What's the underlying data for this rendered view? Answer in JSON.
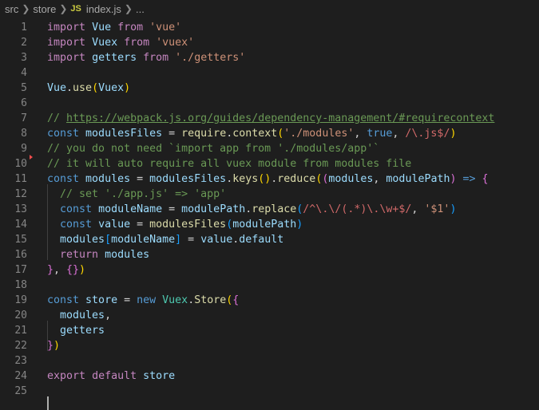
{
  "breadcrumb": {
    "items": [
      "src",
      "store"
    ],
    "file_badge": "JS",
    "file_name": "index.js",
    "ellipsis": "..."
  },
  "editor": {
    "lines": [
      {
        "n": "1",
        "tokens": [
          [
            "kw",
            "import"
          ],
          [
            "op",
            " "
          ],
          [
            "tx",
            "Vue"
          ],
          [
            "op",
            " "
          ],
          [
            "kw",
            "from"
          ],
          [
            "op",
            " "
          ],
          [
            "st",
            "'vue'"
          ]
        ]
      },
      {
        "n": "2",
        "tokens": [
          [
            "kw",
            "import"
          ],
          [
            "op",
            " "
          ],
          [
            "tx",
            "Vuex"
          ],
          [
            "op",
            " "
          ],
          [
            "kw",
            "from"
          ],
          [
            "op",
            " "
          ],
          [
            "st",
            "'vuex'"
          ]
        ]
      },
      {
        "n": "3",
        "tokens": [
          [
            "kw",
            "import"
          ],
          [
            "op",
            " "
          ],
          [
            "tx",
            "getters"
          ],
          [
            "op",
            " "
          ],
          [
            "kw",
            "from"
          ],
          [
            "op",
            " "
          ],
          [
            "st",
            "'./getters'"
          ]
        ]
      },
      {
        "n": "4",
        "tokens": []
      },
      {
        "n": "5",
        "tokens": [
          [
            "tx",
            "Vue"
          ],
          [
            "op",
            "."
          ],
          [
            "fn",
            "use"
          ],
          [
            "bk",
            "("
          ],
          [
            "tx",
            "Vuex"
          ],
          [
            "bk",
            ")"
          ]
        ]
      },
      {
        "n": "6",
        "tokens": []
      },
      {
        "n": "7",
        "tokens": [
          [
            "cm",
            "// "
          ],
          [
            "cmul",
            "https://webpack.js.org/guides/dependency-management/#requirecontext"
          ]
        ]
      },
      {
        "n": "8",
        "tokens": [
          [
            "dc",
            "const"
          ],
          [
            "op",
            " "
          ],
          [
            "tx",
            "modulesFiles"
          ],
          [
            "op",
            " = "
          ],
          [
            "fn",
            "require"
          ],
          [
            "op",
            "."
          ],
          [
            "fn",
            "context"
          ],
          [
            "bk",
            "("
          ],
          [
            "st",
            "'./modules'"
          ],
          [
            "op",
            ", "
          ],
          [
            "dc",
            "true"
          ],
          [
            "op",
            ", "
          ],
          [
            "rg",
            "/\\.js$/"
          ],
          [
            "bk",
            ")"
          ]
        ]
      },
      {
        "n": "9",
        "tokens": [
          [
            "cm",
            "// you do not need `import app from './modules/app'`"
          ]
        ]
      },
      {
        "n": "10",
        "tokens": [
          [
            "cm",
            "// it will auto require all vuex module from modules file"
          ]
        ]
      },
      {
        "n": "11",
        "tokens": [
          [
            "dc",
            "const"
          ],
          [
            "op",
            " "
          ],
          [
            "tx",
            "modules"
          ],
          [
            "op",
            " = "
          ],
          [
            "tx",
            "modulesFiles"
          ],
          [
            "op",
            "."
          ],
          [
            "fn",
            "keys"
          ],
          [
            "bk",
            "()"
          ],
          [
            "op",
            "."
          ],
          [
            "fn",
            "reduce"
          ],
          [
            "bk",
            "("
          ],
          [
            "bk2",
            "("
          ],
          [
            "tx",
            "modules"
          ],
          [
            "op",
            ", "
          ],
          [
            "tx",
            "modulePath"
          ],
          [
            "bk2",
            ")"
          ],
          [
            "op",
            " "
          ],
          [
            "dc",
            "=>"
          ],
          [
            "op",
            " "
          ],
          [
            "bk2",
            "{"
          ]
        ]
      },
      {
        "n": "12",
        "tokens": [
          [
            "op",
            "  "
          ],
          [
            "cm",
            "// set './app.js' => 'app'"
          ]
        ]
      },
      {
        "n": "13",
        "tokens": [
          [
            "op",
            "  "
          ],
          [
            "dc",
            "const"
          ],
          [
            "op",
            " "
          ],
          [
            "tx",
            "moduleName"
          ],
          [
            "op",
            " = "
          ],
          [
            "tx",
            "modulePath"
          ],
          [
            "op",
            "."
          ],
          [
            "fn",
            "replace"
          ],
          [
            "bk3",
            "("
          ],
          [
            "rg",
            "/^\\.\\/(.*)\\.\\w+$/"
          ],
          [
            "op",
            ", "
          ],
          [
            "st",
            "'$1'"
          ],
          [
            "bk3",
            ")"
          ]
        ]
      },
      {
        "n": "14",
        "tokens": [
          [
            "op",
            "  "
          ],
          [
            "dc",
            "const"
          ],
          [
            "op",
            " "
          ],
          [
            "tx",
            "value"
          ],
          [
            "op",
            " = "
          ],
          [
            "fn",
            "modulesFiles"
          ],
          [
            "bk3",
            "("
          ],
          [
            "tx",
            "modulePath"
          ],
          [
            "bk3",
            ")"
          ]
        ]
      },
      {
        "n": "15",
        "tokens": [
          [
            "op",
            "  "
          ],
          [
            "tx",
            "modules"
          ],
          [
            "bk3",
            "["
          ],
          [
            "tx",
            "moduleName"
          ],
          [
            "bk3",
            "]"
          ],
          [
            "op",
            " = "
          ],
          [
            "tx",
            "value"
          ],
          [
            "op",
            "."
          ],
          [
            "tx",
            "default"
          ]
        ]
      },
      {
        "n": "16",
        "tokens": [
          [
            "op",
            "  "
          ],
          [
            "kw",
            "return"
          ],
          [
            "op",
            " "
          ],
          [
            "tx",
            "modules"
          ]
        ]
      },
      {
        "n": "17",
        "tokens": [
          [
            "bk2",
            "}"
          ],
          [
            "op",
            ", "
          ],
          [
            "bk2",
            "{}"
          ],
          [
            "bk",
            ")"
          ]
        ]
      },
      {
        "n": "18",
        "tokens": []
      },
      {
        "n": "19",
        "tokens": [
          [
            "dc",
            "const"
          ],
          [
            "op",
            " "
          ],
          [
            "tx",
            "store"
          ],
          [
            "op",
            " = "
          ],
          [
            "dc",
            "new"
          ],
          [
            "op",
            " "
          ],
          [
            "cl",
            "Vuex"
          ],
          [
            "op",
            "."
          ],
          [
            "fn",
            "Store"
          ],
          [
            "bk",
            "("
          ],
          [
            "bk2",
            "{"
          ]
        ]
      },
      {
        "n": "20",
        "tokens": [
          [
            "op",
            "  "
          ],
          [
            "tx",
            "modules"
          ],
          [
            "op",
            ","
          ]
        ]
      },
      {
        "n": "21",
        "tokens": [
          [
            "op",
            "  "
          ],
          [
            "tx",
            "getters"
          ]
        ]
      },
      {
        "n": "22",
        "tokens": [
          [
            "bk2",
            "}"
          ],
          [
            "bk",
            ")"
          ]
        ]
      },
      {
        "n": "23",
        "tokens": []
      },
      {
        "n": "24",
        "tokens": [
          [
            "kw",
            "export"
          ],
          [
            "op",
            " "
          ],
          [
            "kw",
            "default"
          ],
          [
            "op",
            " "
          ],
          [
            "tx",
            "store"
          ]
        ]
      },
      {
        "n": "25",
        "tokens": []
      }
    ]
  }
}
